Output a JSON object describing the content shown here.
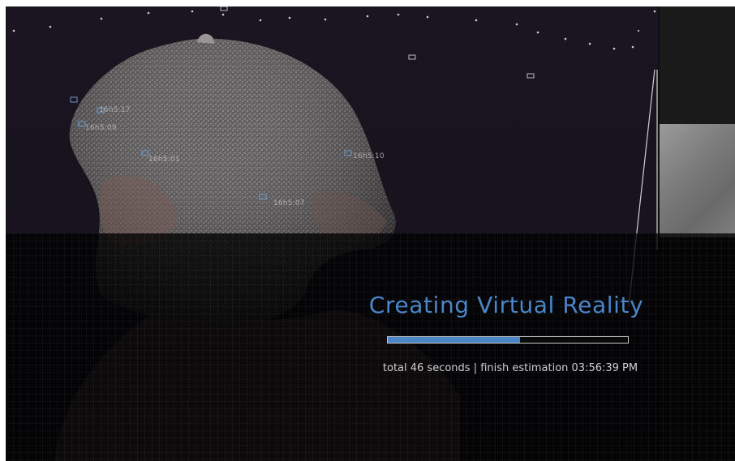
{
  "scene": {
    "camera_labels": [
      "16h5:17",
      "16h5:10",
      "16h5:01",
      "16h5:07",
      "16h5:09"
    ]
  },
  "progress": {
    "title": "Creating Virtual Reality",
    "fraction": 0.55,
    "status": "total 46 seconds | finish estimation 03:56:39 PM"
  },
  "colors": {
    "accent": "#4a86c8",
    "background": "#19141f",
    "overlay": "#000000"
  }
}
